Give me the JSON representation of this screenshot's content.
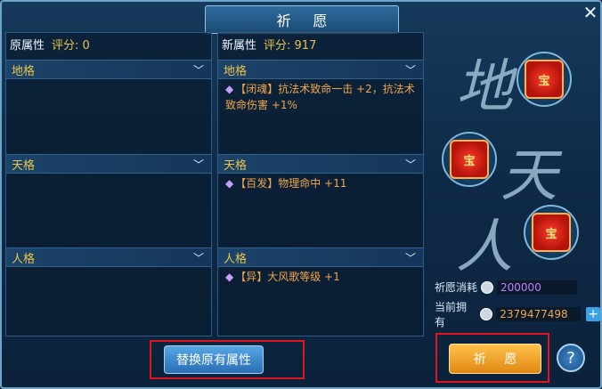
{
  "title": "祈 愿",
  "left_panel": {
    "name": "原属性",
    "score_label": "评分: 0"
  },
  "right_panel": {
    "name": "新属性",
    "score_label": "评分: 917"
  },
  "sections": [
    {
      "label": "地格",
      "attr": "【闭魂】抗法术致命一击 +2，抗法术致命伤害 +1%"
    },
    {
      "label": "天格",
      "attr": "【百发】物理命中 +11"
    },
    {
      "label": "人格",
      "attr": "【异】大风歌等级 +1"
    }
  ],
  "glyphs": {
    "di": "地",
    "tian": "天",
    "ren": "人"
  },
  "item_glyph": "宝",
  "cost": {
    "label": "祈愿消耗",
    "value": "200000"
  },
  "owned": {
    "label": "当前拥有",
    "value": "2379477498"
  },
  "buttons": {
    "replace": "替换原有属性",
    "pray": "祈 愿",
    "help": "?"
  },
  "colors": {
    "highlight": "#e0151b",
    "gold": "#e8c44a",
    "attr": "#f0a64a",
    "cost_value": "#c07cff"
  }
}
